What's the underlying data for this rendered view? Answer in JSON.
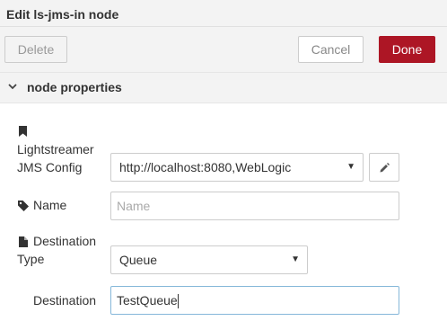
{
  "dialog": {
    "title": "Edit ls-jms-in node"
  },
  "toolbar": {
    "delete_label": "Delete",
    "cancel_label": "Cancel",
    "done_label": "Done"
  },
  "section": {
    "label": "node properties"
  },
  "form": {
    "jms_config": {
      "label_line1": "Lightstreamer",
      "label_line2": "JMS Config",
      "value": "http://localhost:8080,WebLogic",
      "icon": "bookmark-icon"
    },
    "name": {
      "label": "Name",
      "placeholder": "Name",
      "value": "",
      "icon": "tag-icon"
    },
    "destination_type": {
      "label_line1": "Destination",
      "label_line2": "Type",
      "value": "Queue",
      "icon": "file-icon"
    },
    "destination": {
      "label": "Destination",
      "value": "TestQueue"
    }
  },
  "colors": {
    "done_button": "#ad1625",
    "header_bg": "#f3f3f3",
    "focus_border": "#85b7d9"
  }
}
